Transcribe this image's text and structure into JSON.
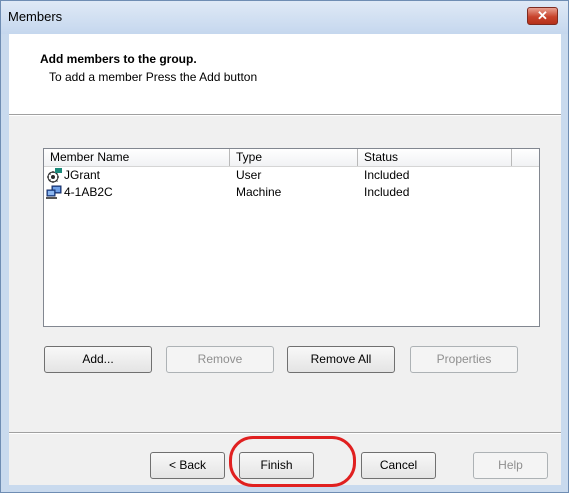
{
  "window": {
    "title": "Members",
    "close_glyph": "✕"
  },
  "header": {
    "title": "Add members to the group.",
    "subtitle": "To add a member Press the Add button"
  },
  "list": {
    "columns": [
      "Member Name",
      "Type",
      "Status"
    ],
    "rows": [
      {
        "name": "JGrant",
        "type": "User",
        "status": "Included",
        "icon": "user-icon"
      },
      {
        "name": "4-1AB2C",
        "type": "Machine",
        "status": "Included",
        "icon": "machine-icon"
      }
    ]
  },
  "list_buttons": {
    "add": "Add...",
    "remove": "Remove",
    "remove_all": "Remove All",
    "properties": "Properties"
  },
  "footer_buttons": {
    "back": "< Back",
    "finish": "Finish",
    "cancel": "Cancel",
    "help": "Help"
  },
  "annotation": {
    "highlight_color": "#e02020"
  }
}
